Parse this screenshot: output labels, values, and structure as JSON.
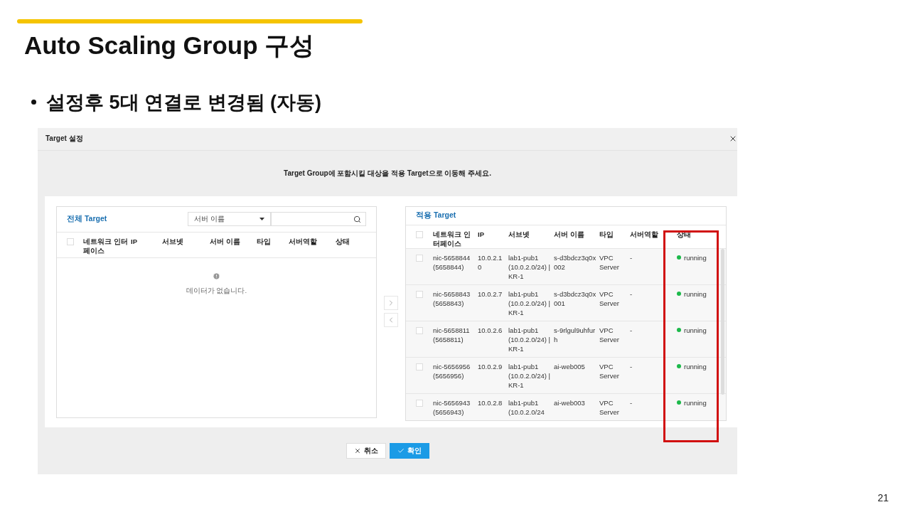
{
  "slide": {
    "title": "Auto Scaling Group 구성",
    "bullet": "설정후 5대 연결로 변경됨 (자동)",
    "page_number": "21"
  },
  "dialog": {
    "title": "Target 설정",
    "message": "Target Group에 포함시킬 대상을 적용 Target으로 이동해 주세요.",
    "all_panel": {
      "title": "전체 Target",
      "filter_select": {
        "value": "서버 이름"
      },
      "select_all_checked": false,
      "columns": [
        "네트워크 인터페이스",
        "IP",
        "서브넷",
        "서버 이름",
        "타입",
        "서버역할",
        "상태"
      ],
      "empty_message": "데이터가 없습니다."
    },
    "applied_panel": {
      "title": "적용 Target",
      "select_all_checked": false,
      "columns": [
        "네트워크 인터페이스",
        "IP",
        "서브넷",
        "서버 이름",
        "타입",
        "서버역할",
        "상태"
      ],
      "rows": [
        {
          "checked": false,
          "nic": "nic-5658844 (5658844)",
          "ip": "10.0.2.10",
          "subnet": "lab1-pub1 (10.0.2.0/24) | KR-1",
          "server_name": "s-d3bdcz3q0x002",
          "type": "VPC Server",
          "role": "-",
          "status": "running"
        },
        {
          "checked": false,
          "nic": "nic-5658843 (5658843)",
          "ip": "10.0.2.7",
          "subnet": "lab1-pub1 (10.0.2.0/24) | KR-1",
          "server_name": "s-d3bdcz3q0x001",
          "type": "VPC Server",
          "role": "-",
          "status": "running"
        },
        {
          "checked": false,
          "nic": "nic-5658811 (5658811)",
          "ip": "10.0.2.6",
          "subnet": "lab1-pub1 (10.0.2.0/24) | KR-1",
          "server_name": "s-9rlgul9uhfurh",
          "type": "VPC Server",
          "role": "-",
          "status": "running"
        },
        {
          "checked": false,
          "nic": "nic-5656956 (5656956)",
          "ip": "10.0.2.9",
          "subnet": "lab1-pub1 (10.0.2.0/24) | KR-1",
          "server_name": "ai-web005",
          "type": "VPC Server",
          "role": "-",
          "status": "running"
        },
        {
          "checked": false,
          "nic": "nic-5656943 (5656943)",
          "ip": "10.0.2.8",
          "subnet": "lab1-pub1 (10.0.2.0/24",
          "server_name": "ai-web003",
          "type": "VPC Server",
          "role": "-",
          "status": "running"
        }
      ]
    },
    "buttons": [
      {
        "label": "취소",
        "kind": "cancel"
      },
      {
        "label": "확인",
        "kind": "confirm"
      }
    ]
  }
}
